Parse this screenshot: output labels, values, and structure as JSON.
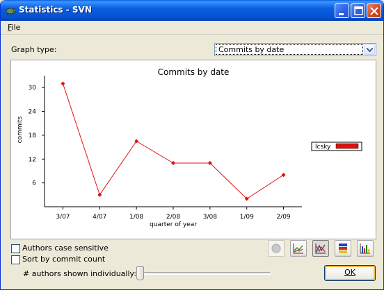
{
  "window": {
    "title": "Statistics - SVN",
    "icon": "tortoise-icon"
  },
  "titlebar_buttons": {
    "minimize": "minimize-icon",
    "maximize": "maximize-icon",
    "close": "close-icon"
  },
  "menubar": {
    "items": [
      {
        "label": "File",
        "mnemonic": "F"
      }
    ]
  },
  "graph_type": {
    "label": "Graph type:",
    "selected": "Commits by date"
  },
  "chart_data": {
    "type": "line",
    "title": "Commits by date",
    "xlabel": "quarter of year",
    "ylabel": "commits",
    "categories": [
      "3/07",
      "4/07",
      "1/08",
      "2/08",
      "3/08",
      "1/09",
      "2/09"
    ],
    "yticks": [
      6,
      12,
      18,
      24,
      30
    ],
    "ylim": [
      0,
      33
    ],
    "series": [
      {
        "name": "lcsky",
        "color": "#e01010",
        "values": [
          31,
          3,
          16.5,
          11,
          11,
          2,
          8
        ]
      }
    ],
    "legend": "right",
    "grid": false
  },
  "options": {
    "case_sensitive": {
      "label": "Authors case sensitive",
      "checked": false
    },
    "sort_by_count": {
      "label": "Sort by commit count",
      "checked": false
    }
  },
  "chart_buttons": [
    {
      "name": "pie-chart-icon",
      "enabled": false
    },
    {
      "name": "line-chart-icon",
      "enabled": true
    },
    {
      "name": "stacked-line-chart-icon",
      "enabled": true,
      "pressed": true
    },
    {
      "name": "stacked-bar-chart-icon",
      "enabled": true
    },
    {
      "name": "bar-chart-icon",
      "enabled": true
    }
  ],
  "slider": {
    "label": "# authors shown individually:"
  },
  "ok_button": {
    "label": "OK"
  },
  "colors": {
    "title_bar": "#0a5fe0",
    "series": "#e01010",
    "window_bg": "#ece9d8"
  }
}
